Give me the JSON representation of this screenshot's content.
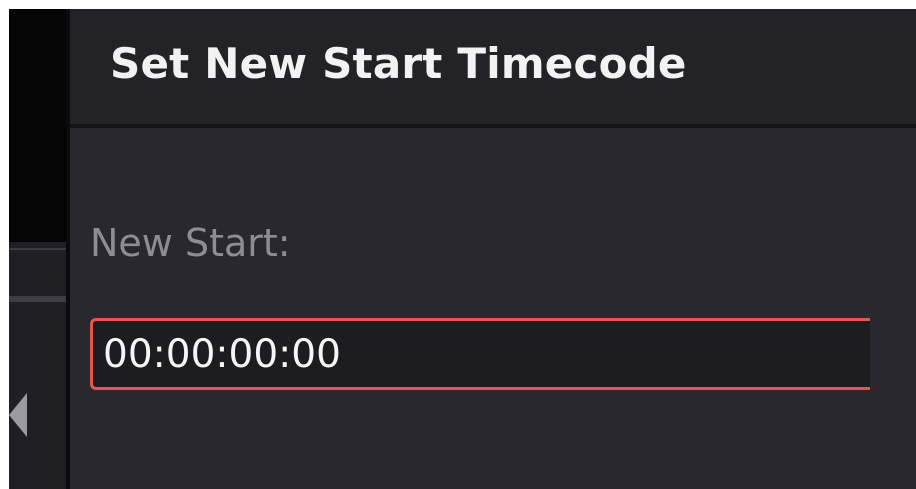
{
  "dialog": {
    "title": "Set New Start Timecode",
    "field_label": "New Start:",
    "timecode_value": "00:00:00:00",
    "focus_color": "#e4584b"
  },
  "background": {
    "collapse_arrow_icon": "triangle-left-icon"
  }
}
